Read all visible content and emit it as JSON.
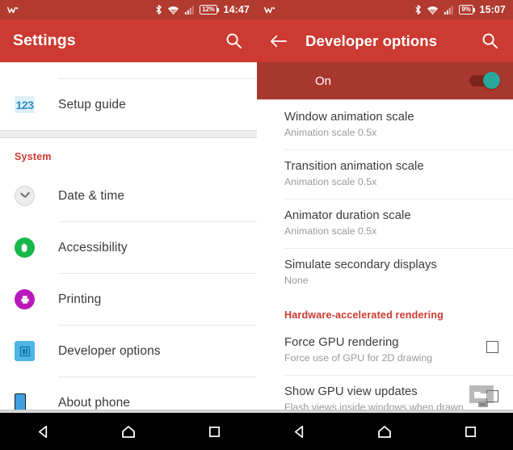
{
  "left_panel": {
    "status_bar": {
      "walkman_icon": "walkman-icon",
      "bluetooth_icon": "bluetooth-icon",
      "wifi_icon": "wifi-icon",
      "signal_icon": "cellular-signal-icon",
      "battery_percent": "12%",
      "clock": "14:47"
    },
    "app_bar": {
      "title": "Settings",
      "search_icon": "search-icon"
    },
    "items": [
      {
        "label": "Setup guide",
        "icon": "numbers-123-icon"
      }
    ],
    "section_header": "System",
    "system_items": [
      {
        "label": "Date & time",
        "icon": "clock-icon"
      },
      {
        "label": "Accessibility",
        "icon": "accessibility-hand-icon"
      },
      {
        "label": "Printing",
        "icon": "printer-icon"
      },
      {
        "label": "Developer options",
        "icon": "developer-options-icon"
      },
      {
        "label": "About phone",
        "icon": "phone-icon"
      }
    ],
    "nav_bar": {
      "back": "back-icon",
      "home": "home-icon",
      "recents": "recents-icon"
    }
  },
  "right_panel": {
    "status_bar": {
      "walkman_icon": "walkman-icon",
      "bluetooth_icon": "bluetooth-icon",
      "wifi_icon": "wifi-icon",
      "signal_icon": "cellular-signal-icon",
      "battery_percent": "9%",
      "clock": "15:07"
    },
    "app_bar": {
      "back_icon": "back-arrow-icon",
      "title": "Developer options",
      "search_icon": "search-icon"
    },
    "master_switch": {
      "label": "On",
      "state": "on"
    },
    "rows": [
      {
        "title": "Window animation scale",
        "subtitle": "Animation scale 0.5x",
        "checkbox": false
      },
      {
        "title": "Transition animation scale",
        "subtitle": "Animation scale 0.5x",
        "checkbox": false
      },
      {
        "title": "Animator duration scale",
        "subtitle": "Animation scale 0.5x",
        "checkbox": false
      },
      {
        "title": "Simulate secondary displays",
        "subtitle": "None",
        "checkbox": false
      }
    ],
    "section_header": "Hardware-accelerated rendering",
    "hw_rows": [
      {
        "title": "Force GPU rendering",
        "subtitle": "Force use of GPU for 2D drawing",
        "checkbox": true
      },
      {
        "title": "Show GPU view updates",
        "subtitle": "Flash views inside windows when drawn with",
        "checkbox": true
      }
    ],
    "nav_bar": {
      "back": "back-icon",
      "home": "home-icon",
      "recents": "recents-icon"
    }
  },
  "colors": {
    "app_bar_red": "#cc3a31",
    "status_bar_red": "#b23a2e",
    "switch_row_red": "#a8382e",
    "accent_red": "#cc3a31",
    "toggle_teal": "#2aa79c",
    "nav_bar_black": "#000000"
  }
}
